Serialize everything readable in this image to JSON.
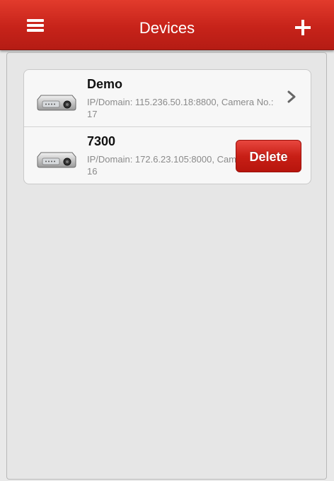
{
  "header": {
    "title": "Devices",
    "menu_icon": "hamburger-menu-icon",
    "add_icon": "plus-icon",
    "color": "#c7231a"
  },
  "devices": [
    {
      "name": "Demo",
      "info": "IP/Domain: 115.236.50.18:8800, Camera No.: 17",
      "icon": "dvr-device-icon",
      "accessory": "chevron-right-icon"
    },
    {
      "name": "7300",
      "info": "IP/Domain: 172.6.23.105:8000, Camera No.: 16",
      "icon": "dvr-device-icon",
      "action_label": "Delete",
      "action_color": "#c81f16"
    }
  ]
}
